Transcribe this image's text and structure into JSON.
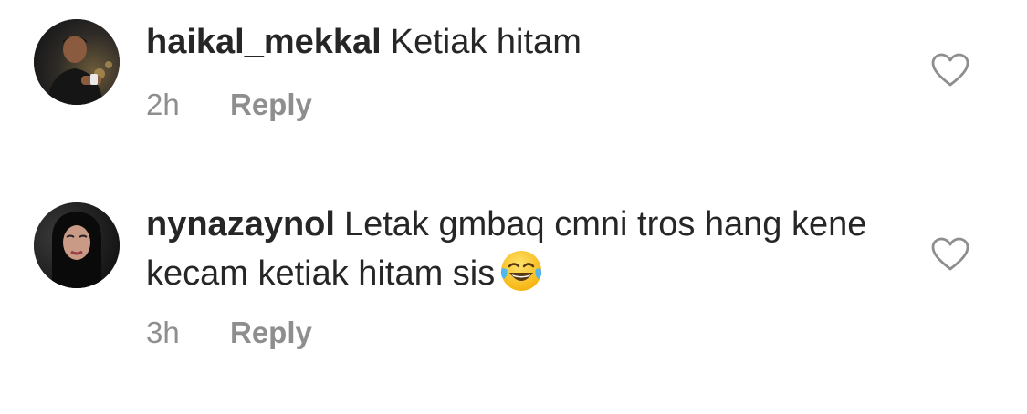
{
  "comments": [
    {
      "username": "haikal_mekkal",
      "text": "Ketiak hitam",
      "time": "2h",
      "reply_label": "Reply",
      "like_icon": "heart-outline-icon"
    },
    {
      "username": "nynazaynol",
      "text": "Letak gmbaq cmni tros hang kene kecam ketiak hitam sis",
      "emoji": "face-with-tears-of-joy",
      "time": "3h",
      "reply_label": "Reply",
      "like_icon": "heart-outline-icon"
    }
  ],
  "colors": {
    "text_primary": "#262626",
    "text_secondary": "#8e8e8e",
    "background": "#ffffff"
  }
}
